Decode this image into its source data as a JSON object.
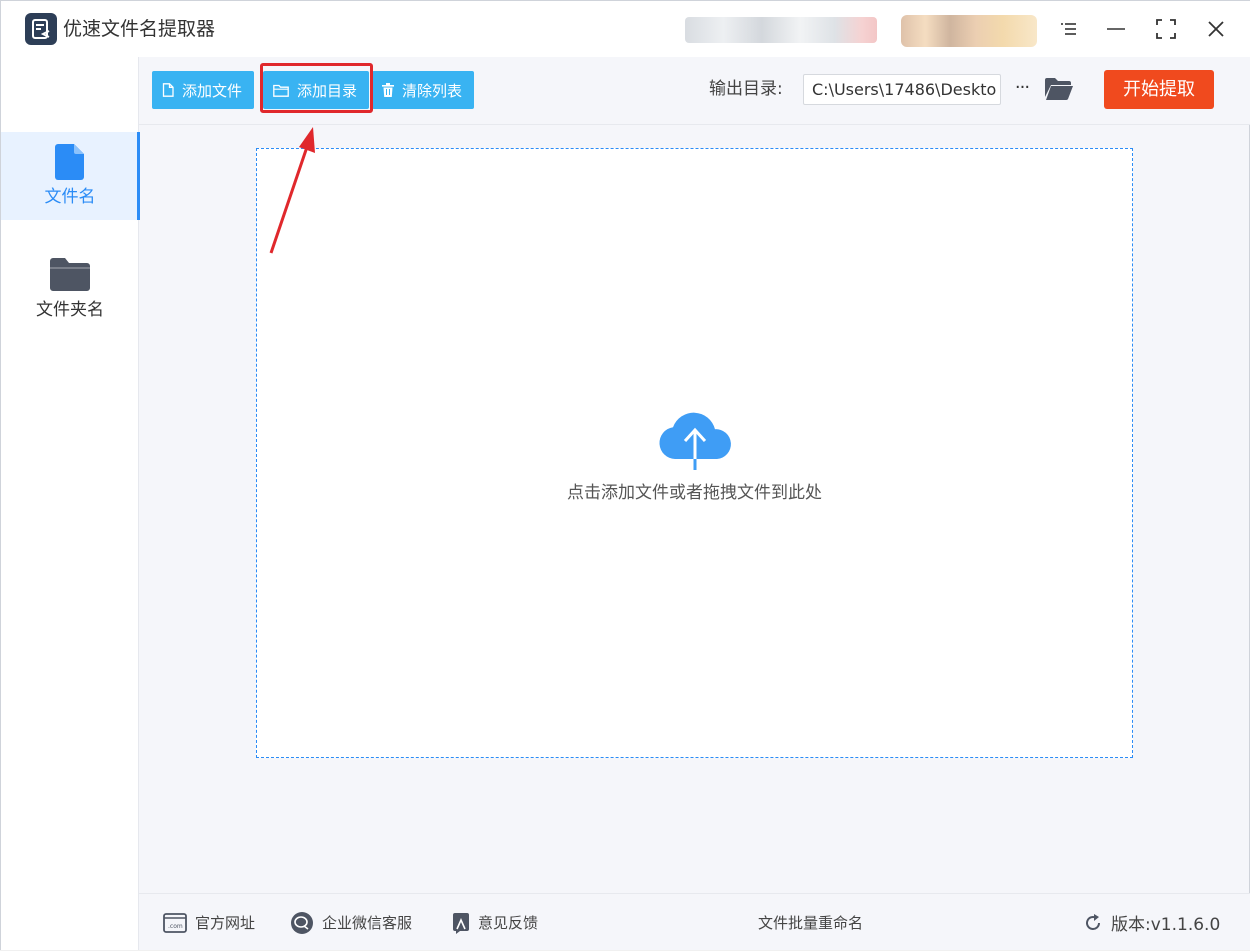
{
  "app": {
    "title": "优速文件名提取器"
  },
  "sidebar": {
    "items": [
      {
        "label": "文件名",
        "icon": "file-icon",
        "active": true
      },
      {
        "label": "文件夹名",
        "icon": "folder-icon",
        "active": false
      }
    ]
  },
  "toolbar": {
    "add_file": "添加文件",
    "add_dir": "添加目录",
    "clear_list": "清除列表",
    "output_label": "输出目录:",
    "output_path": "C:\\Users\\17486\\Deskto",
    "more": "···",
    "start": "开始提取"
  },
  "dropzone": {
    "hint": "点击添加文件或者拖拽文件到此处",
    "icon": "cloud-upload-icon"
  },
  "footer": {
    "website": "官方网址",
    "wechat": "企业微信客服",
    "feedback": "意见反馈",
    "center": "文件批量重命名",
    "version": "版本:v1.1.6.0"
  },
  "colors": {
    "accent": "#2b8cf6",
    "toolbar_button": "#39b3f2",
    "start_button": "#f04a1e",
    "annotation": "#e0282c"
  }
}
